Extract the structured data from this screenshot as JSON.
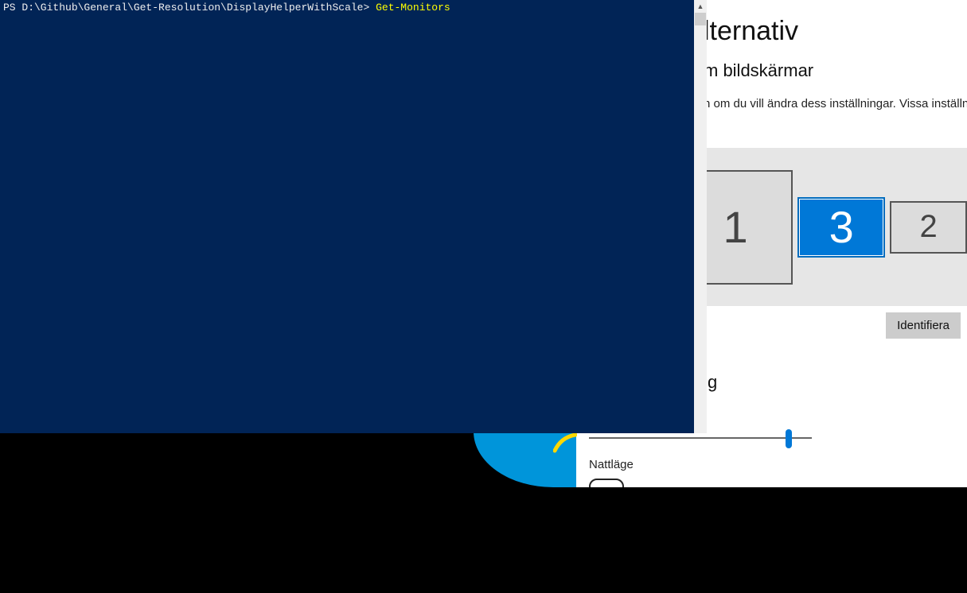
{
  "powershell": {
    "prompt_prefix": "PS ",
    "path": "D:\\Github\\General\\Get-Resolution\\DisplayHelperWithScale>",
    "command": "Get-Monitors"
  },
  "settings": {
    "title_partial": "lternativ",
    "subtitle_partial": "m bildskärmar",
    "desc_partial": "n om du vill ändra dess inställningar. Vissa inställn",
    "section_partial": "g",
    "nattlage_label": "Nattläge",
    "identify_label": "Identifiera",
    "monitors": [
      {
        "id": "1",
        "selected": false
      },
      {
        "id": "3",
        "selected": true
      },
      {
        "id": "2",
        "selected": false
      }
    ]
  }
}
